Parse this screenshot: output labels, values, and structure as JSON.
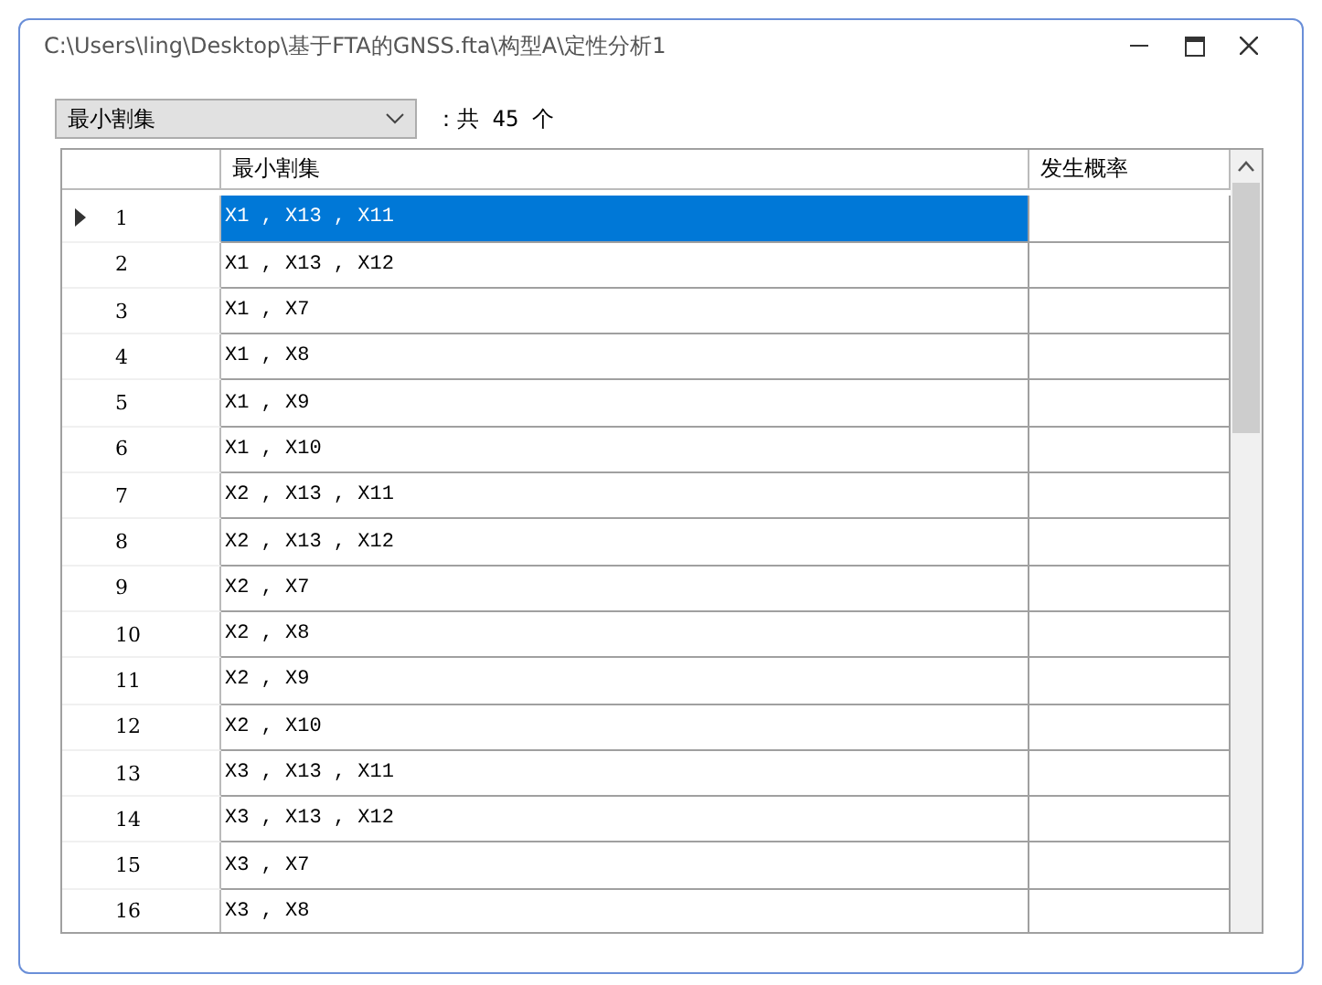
{
  "window": {
    "title": "C:\\Users\\ling\\Desktop\\基于FTA的GNSS.fta\\构型A\\定性分析1"
  },
  "selector": {
    "value": "最小割集",
    "count_text": "：共 45 个"
  },
  "table": {
    "columns": [
      "最小割集",
      "发生概率"
    ],
    "rows": [
      {
        "index": "1",
        "cut_set": "X1 , X13 , X11",
        "selected": true
      },
      {
        "index": "2",
        "cut_set": "X1 , X13 , X12",
        "selected": false
      },
      {
        "index": "3",
        "cut_set": "X1 , X7",
        "selected": false
      },
      {
        "index": "4",
        "cut_set": "X1 , X8",
        "selected": false
      },
      {
        "index": "5",
        "cut_set": "X1 , X9",
        "selected": false
      },
      {
        "index": "6",
        "cut_set": "X1 , X10",
        "selected": false
      },
      {
        "index": "7",
        "cut_set": "X2 , X13 , X11",
        "selected": false
      },
      {
        "index": "8",
        "cut_set": "X2 , X13 , X12",
        "selected": false
      },
      {
        "index": "9",
        "cut_set": "X2 , X7",
        "selected": false
      },
      {
        "index": "10",
        "cut_set": "X2 , X8",
        "selected": false
      },
      {
        "index": "11",
        "cut_set": "X2 , X9",
        "selected": false
      },
      {
        "index": "12",
        "cut_set": "X2 , X10",
        "selected": false
      },
      {
        "index": "13",
        "cut_set": "X3 , X13 , X11",
        "selected": false
      },
      {
        "index": "14",
        "cut_set": "X3 , X13 , X12",
        "selected": false
      },
      {
        "index": "15",
        "cut_set": "X3 , X7",
        "selected": false
      },
      {
        "index": "16",
        "cut_set": "X3 , X8",
        "selected": false
      }
    ]
  }
}
